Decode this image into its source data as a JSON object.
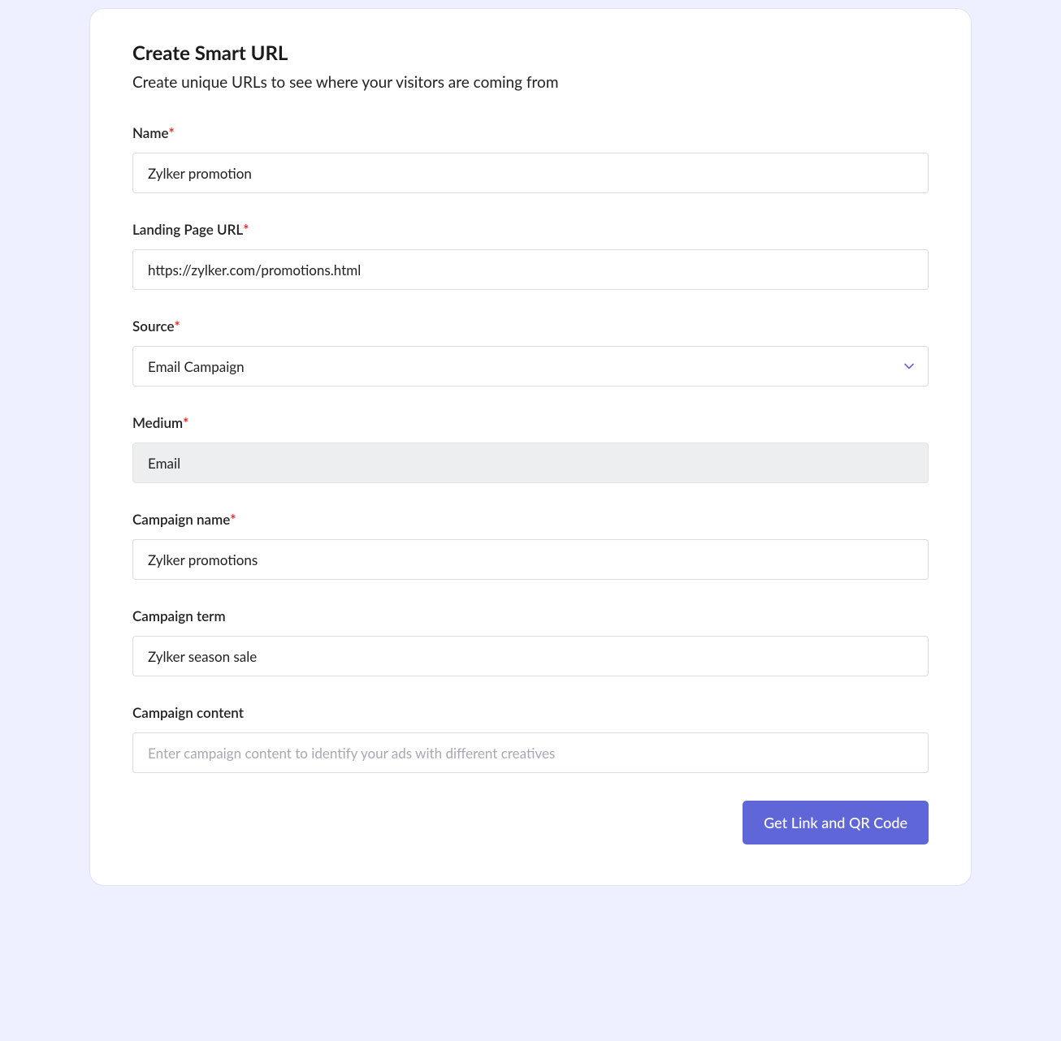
{
  "header": {
    "title": "Create Smart URL",
    "subtitle": "Create unique URLs to see where your visitors are coming from"
  },
  "form": {
    "name": {
      "label": "Name",
      "required": true,
      "value": "Zylker promotion"
    },
    "landing_page_url": {
      "label": "Landing Page URL",
      "required": true,
      "value": "https://zylker.com/promotions.html"
    },
    "source": {
      "label": "Source",
      "required": true,
      "selected": "Email Campaign"
    },
    "medium": {
      "label": "Medium",
      "required": true,
      "value": "Email"
    },
    "campaign_name": {
      "label": "Campaign name",
      "required": true,
      "value": "Zylker promotions"
    },
    "campaign_term": {
      "label": "Campaign term",
      "required": false,
      "value": "Zylker season sale"
    },
    "campaign_content": {
      "label": "Campaign content",
      "required": false,
      "value": "",
      "placeholder": "Enter campaign content to identify your ads with different creatives"
    }
  },
  "actions": {
    "submit_label": "Get Link and QR Code"
  }
}
